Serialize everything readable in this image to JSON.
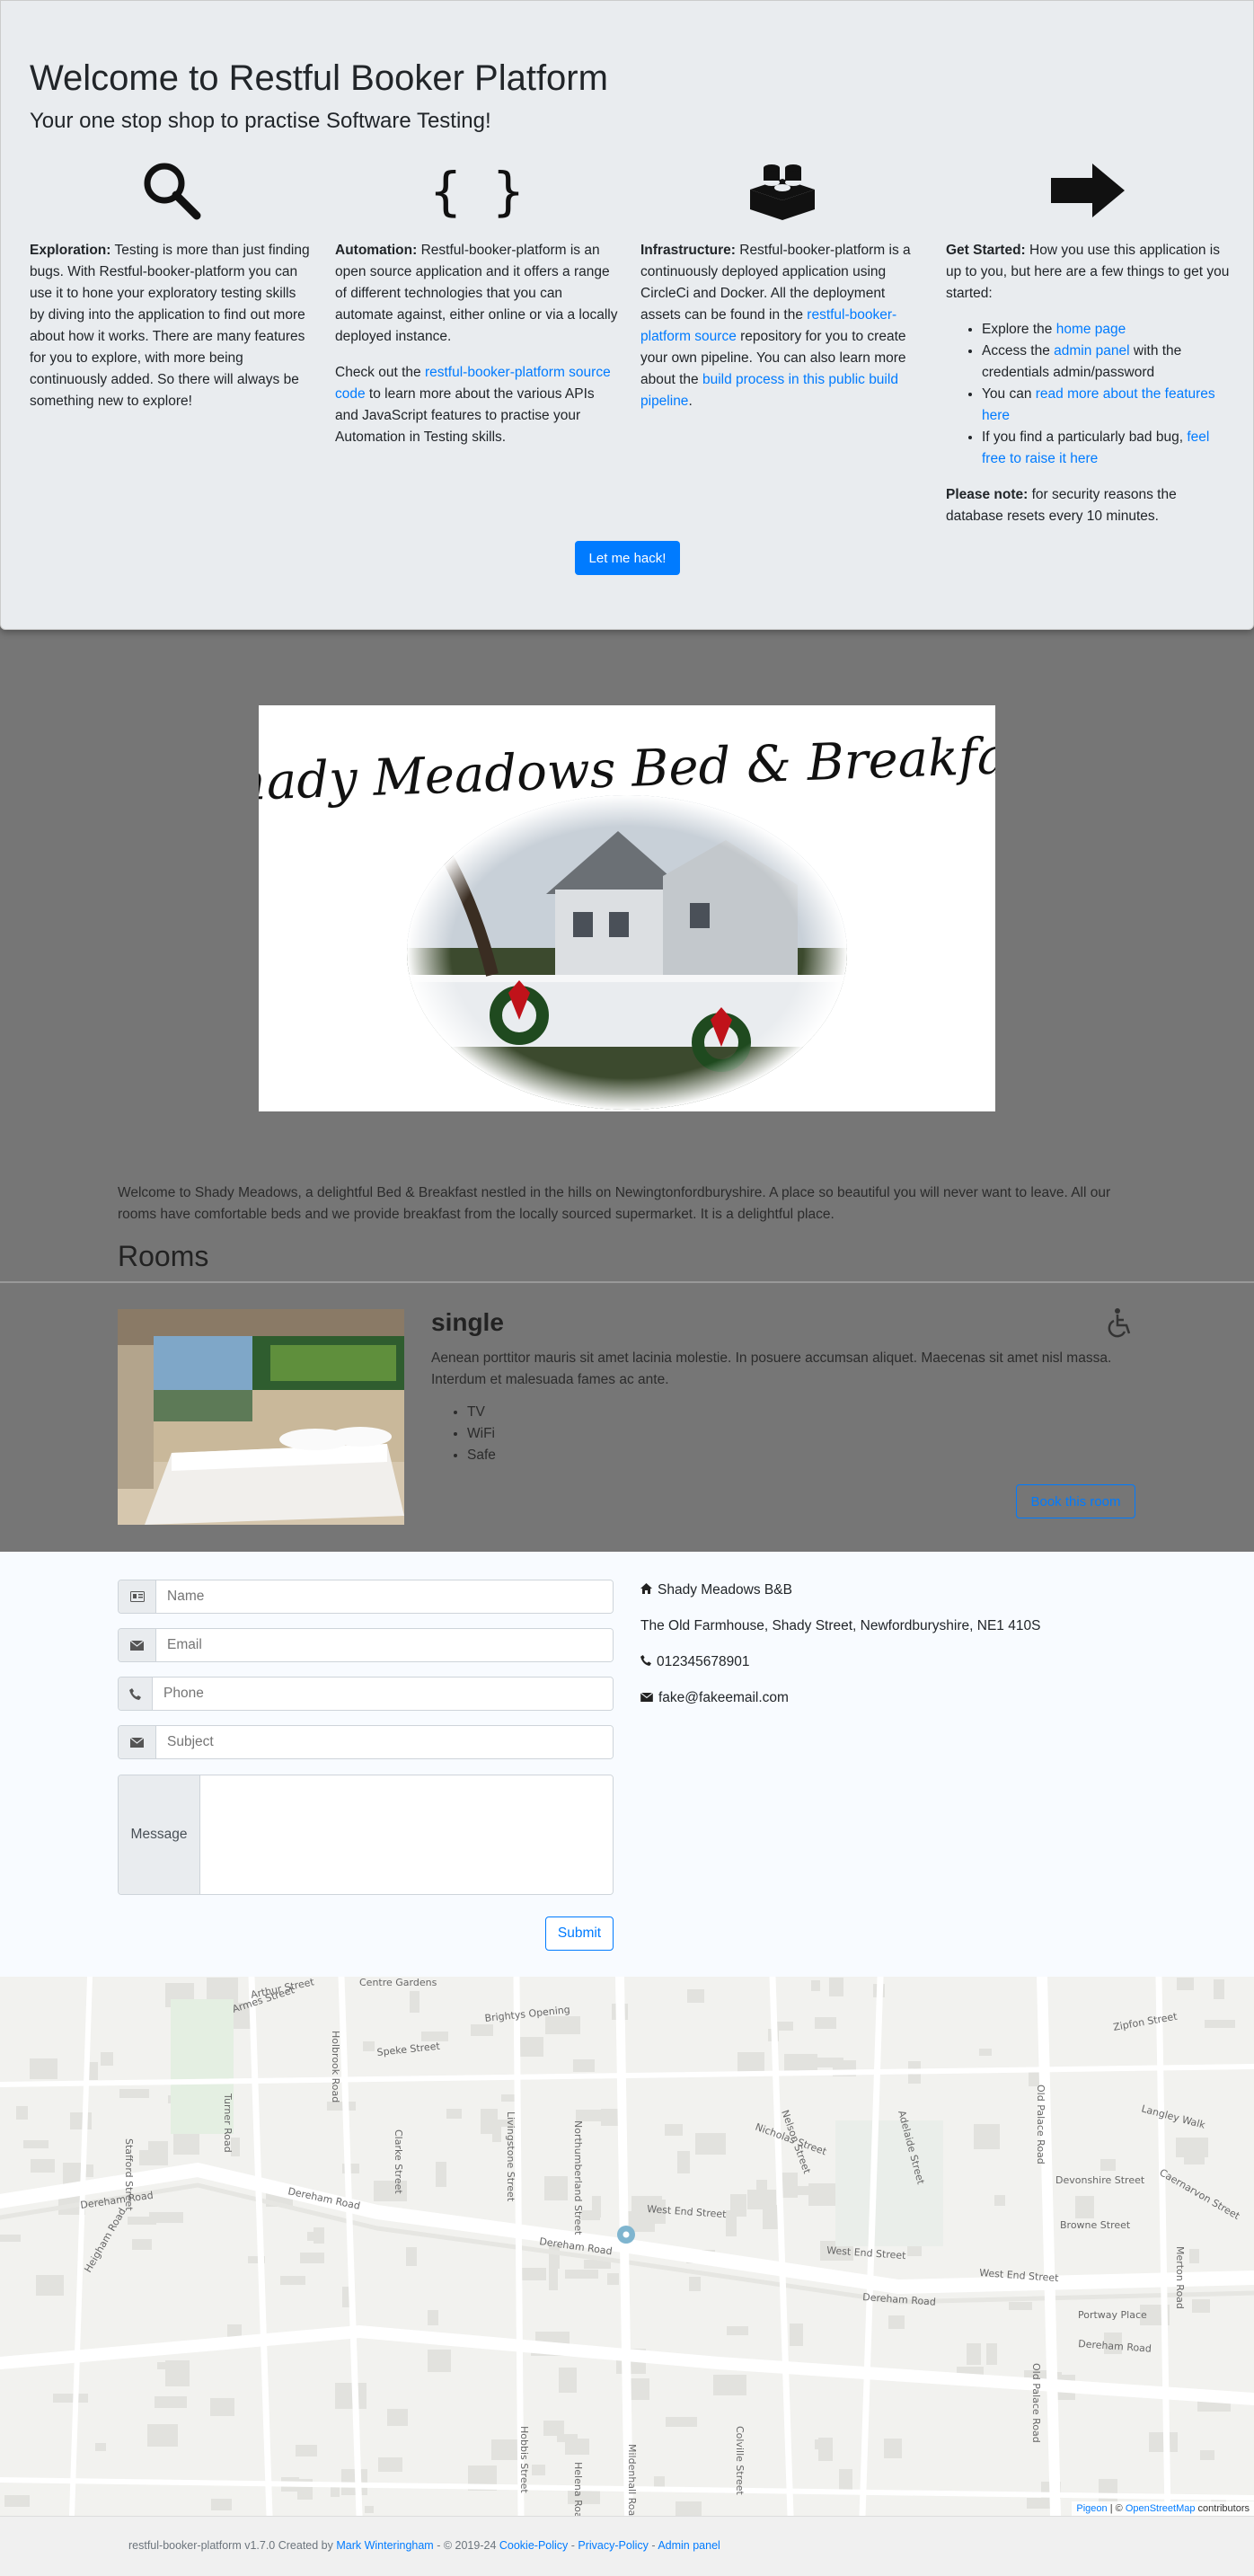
{
  "welcome": {
    "title": "Welcome to Restful Booker Platform",
    "subtitle": "Your one stop shop to practise Software Testing!",
    "exploration": {
      "label": "Exploration:",
      "text": " Testing is more than just finding bugs. With Restful-booker-platform you can use it to hone your exploratory testing skills by diving into the application to find out more about how it works. There are many features for you to explore, with more being continuously added. So there will always be something new to explore!"
    },
    "automation": {
      "label": "Automation:",
      "text": " Restful-booker-platform is an open source application and it offers a range of different technologies that you can automate against, either online or via a locally deployed instance.",
      "p2_before": "Check out the ",
      "p2_link": "restful-booker-platform source code",
      "p2_after": " to learn more about the various APIs and JavaScript features to practise your Automation in Testing skills."
    },
    "infrastructure": {
      "label": "Infrastructure:",
      "text1": " Restful-booker-platform is a continuously deployed application using CircleCi and Docker. All the deployment assets can be found in the ",
      "link1": "restful-booker-platform source",
      "text2": " repository for you to create your own pipeline. You can also learn more about the ",
      "link2": "build process in this public build pipeline",
      "text3": "."
    },
    "get_started": {
      "label": "Get Started:",
      "text": " How you use this application is up to you, but here are a few things to get you started:",
      "items": [
        {
          "before": "Explore the ",
          "link": "home page",
          "after": ""
        },
        {
          "before": "Access the ",
          "link": "admin panel",
          "after": " with the credentials admin/password"
        },
        {
          "before": "You can ",
          "link": "read more about the features here",
          "after": ""
        },
        {
          "before": "If you find a particularly bad bug, ",
          "link": "feel free to raise it here",
          "after": ""
        }
      ],
      "note_label": "Please note:",
      "note_text": " for security reasons the database resets every 10 minutes."
    },
    "hack_button": "Let me hack!"
  },
  "hero": {
    "logo_text": "Shady Meadows Bed & Breakfast"
  },
  "intro": "Welcome to Shady Meadows, a delightful Bed & Breakfast nestled in the hills on Newingtonfordburyshire. A place so beautiful you will never want to leave. All our rooms have comfortable beds and we provide breakfast from the locally sourced supermarket. It is a delightful place.",
  "rooms": {
    "heading": "Rooms",
    "items": [
      {
        "title": "single",
        "description": "Aenean porttitor mauris sit amet lacinia molestie. In posuere accumsan aliquet. Maecenas sit amet nisl massa. Interdum et malesuada fames ac ante.",
        "features": [
          "TV",
          "WiFi",
          "Safe"
        ],
        "book_label": "Book this room"
      }
    ]
  },
  "contact_form": {
    "name_placeholder": "Name",
    "email_placeholder": "Email",
    "phone_placeholder": "Phone",
    "subject_placeholder": "Subject",
    "message_label": "Message",
    "submit_label": "Submit"
  },
  "contact_info": {
    "name": "Shady Meadows B&B",
    "address": "The Old Farmhouse, Shady Street, Newfordburyshire, NE1 410S",
    "phone": "012345678901",
    "email": "fake@fakeemail.com"
  },
  "map": {
    "streets": [
      "Dereham Road",
      "Dereham Road",
      "Dereham Road",
      "Dereham Road",
      "Dereham Road",
      "West End Street",
      "West End Street",
      "West End Street",
      "Old Palace Road",
      "Old Palace Road",
      "Northumberland Street",
      "Speke Street",
      "Brightys Opening",
      "Armes Street",
      "Arthur Street",
      "Holbrook Road",
      "Clarke Street",
      "Livingstone Street",
      "Nelson Street",
      "Adelaide Street",
      "Nicholas Street",
      "Devonshire Street",
      "Browne Street",
      "Turner Road",
      "Stafford Street",
      "Zipfon Street",
      "Langley Walk",
      "Caernarvon Street",
      "Portway Place",
      "Heigham Road",
      "Merton Road",
      "Hobbis Street",
      "Mildenhall Road",
      "Helena Road",
      "Colville Street",
      "Centre Gardens"
    ],
    "attribution": {
      "pigeon": "Pigeon",
      "sep": " | © ",
      "osm": "OpenStreetMap",
      "tail": " contributors"
    }
  },
  "footer": {
    "text1": "restful-booker-platform v1.7.0 Created by ",
    "author": "Mark Winteringham",
    "text2": " - © 2019-24 ",
    "cookie": "Cookie-Policy",
    "sep1": " - ",
    "privacy": "Privacy-Policy",
    "sep2": " - ",
    "admin": "Admin panel"
  }
}
